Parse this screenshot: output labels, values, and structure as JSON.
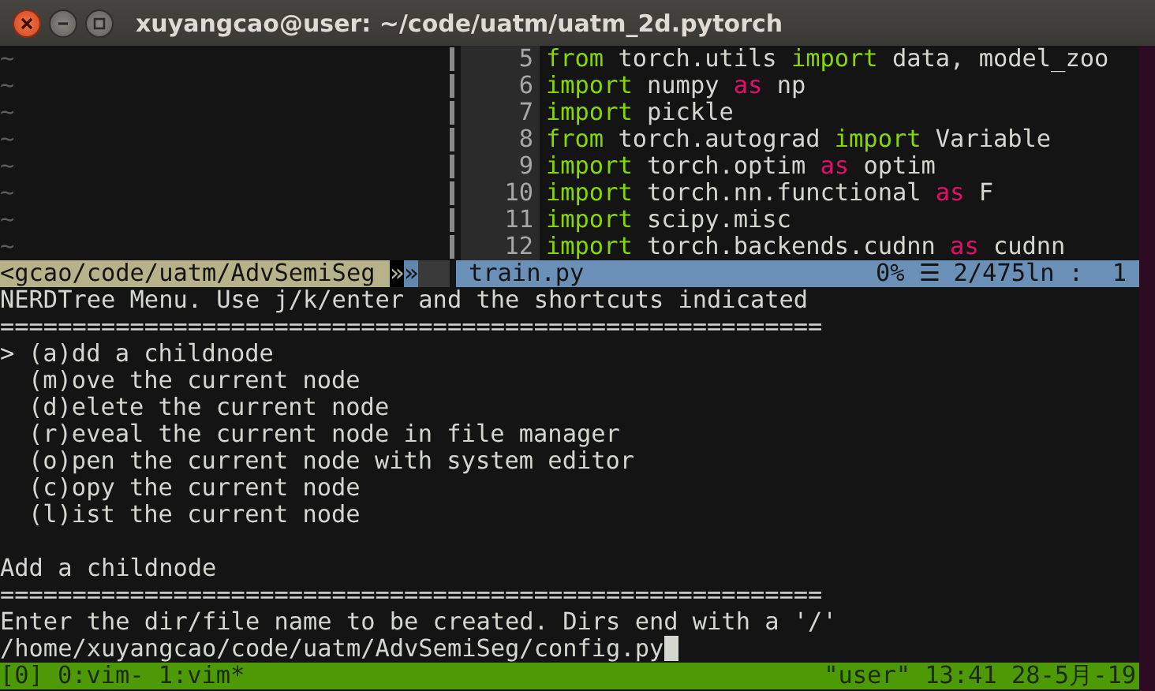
{
  "window": {
    "title": "xuyangcao@user: ~/code/uatm/uatm_2d.pytorch"
  },
  "left_pane": {
    "empty_lines": [
      "~",
      "~",
      "~",
      "~",
      "~",
      "~",
      "~",
      "~"
    ]
  },
  "code_lines": [
    {
      "number": "5",
      "tokens": [
        {
          "text": "from",
          "kind": "keyword"
        },
        {
          "text": " torch.utils ",
          "kind": "plain"
        },
        {
          "text": "import",
          "kind": "keyword"
        },
        {
          "text": " data, model_zoo",
          "kind": "plain"
        }
      ]
    },
    {
      "number": "6",
      "tokens": [
        {
          "text": "import",
          "kind": "keyword"
        },
        {
          "text": " numpy ",
          "kind": "plain"
        },
        {
          "text": "as",
          "kind": "alias"
        },
        {
          "text": " np",
          "kind": "plain"
        }
      ]
    },
    {
      "number": "7",
      "tokens": [
        {
          "text": "import",
          "kind": "keyword"
        },
        {
          "text": " pickle",
          "kind": "plain"
        }
      ]
    },
    {
      "number": "8",
      "tokens": [
        {
          "text": "from",
          "kind": "keyword"
        },
        {
          "text": " torch.autograd ",
          "kind": "plain"
        },
        {
          "text": "import",
          "kind": "keyword"
        },
        {
          "text": " Variable",
          "kind": "plain"
        }
      ]
    },
    {
      "number": "9",
      "tokens": [
        {
          "text": "import",
          "kind": "keyword"
        },
        {
          "text": " torch.optim ",
          "kind": "plain"
        },
        {
          "text": "as",
          "kind": "alias"
        },
        {
          "text": " optim",
          "kind": "plain"
        }
      ]
    },
    {
      "number": "10",
      "tokens": [
        {
          "text": "import",
          "kind": "keyword"
        },
        {
          "text": " torch.nn.functional ",
          "kind": "plain"
        },
        {
          "text": "as",
          "kind": "alias"
        },
        {
          "text": " F",
          "kind": "plain"
        }
      ]
    },
    {
      "number": "11",
      "tokens": [
        {
          "text": "import",
          "kind": "keyword"
        },
        {
          "text": " scipy.misc",
          "kind": "plain"
        }
      ]
    },
    {
      "number": "12",
      "tokens": [
        {
          "text": "import",
          "kind": "keyword"
        },
        {
          "text": " torch.backends.cudnn ",
          "kind": "plain"
        },
        {
          "text": "as",
          "kind": "alias"
        },
        {
          "text": " cudnn",
          "kind": "plain"
        }
      ]
    }
  ],
  "status_line": {
    "left_path": "<gcao/code/uatm/AdvSemiSeg",
    "arrow_left": "»",
    "arrow_right": "»",
    "file_name": "train.py",
    "percent": "0%",
    "menu_glyph": "☰",
    "position": "2/475ln :  1"
  },
  "nerdtree": {
    "title": "NERDTree Menu. Use j/k/enter and the shortcuts indicated",
    "separator": "=========================================================",
    "cursor": ">",
    "items": [
      {
        "label": "(a)dd a childnode",
        "selected": true
      },
      {
        "label": "(m)ove the current node",
        "selected": false
      },
      {
        "label": "(d)elete the current node",
        "selected": false
      },
      {
        "label": "(r)eveal the current node in file manager",
        "selected": false
      },
      {
        "label": "(o)pen the current node with system editor",
        "selected": false
      },
      {
        "label": "(c)opy the current node",
        "selected": false
      },
      {
        "label": "(l)ist the current node",
        "selected": false
      }
    ],
    "action_title": "Add a childnode",
    "separator_2": "=========================================================",
    "prompt": "Enter the dir/file name to be created. Dirs end with a '/'",
    "input_value": "/home/xuyangcao/code/uatm/AdvSemiSeg/config.py"
  },
  "tmux": {
    "session": "[0]",
    "windows": [
      "0:vim-",
      "1:vim*"
    ],
    "right": "\"user\" 13:41 28-5月-19"
  }
}
